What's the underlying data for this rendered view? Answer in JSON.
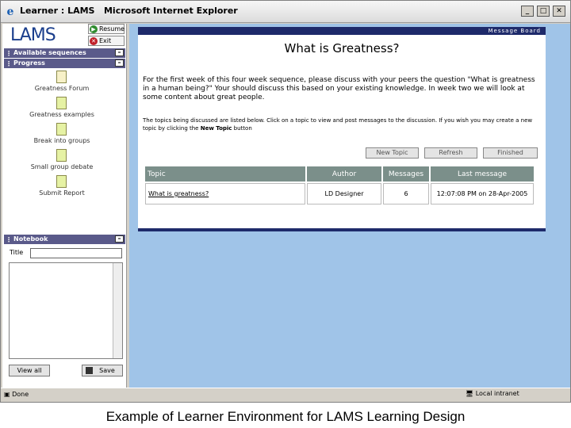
{
  "window": {
    "title": "Learner : LAMS   Microsoft Internet Explorer"
  },
  "sidebar": {
    "logo": "LAMS",
    "resume_label": "Resume",
    "exit_label": "Exit",
    "available_sequences": "Available sequences",
    "progress_title": "Progress",
    "activities": [
      "Greatness Forum",
      "Greatness examples",
      "Break into groups",
      "Small group debate",
      "Submit Report"
    ],
    "notebook": {
      "title": "Notebook",
      "title_label": "Title",
      "view_all": "View all",
      "save": "Save"
    }
  },
  "board": {
    "label": "Message Board",
    "heading": "What is Greatness?",
    "intro": "For the first week of this four week sequence, please discuss with your peers the question \"What is greatness in a human being?\" Your should discuss this based on your existing knowledge. In week two we will look at some content about great people.",
    "instructions_prefix": "The topics being discussed are listed below. Click on a topic to view and post messages to the discussion. If you wish you may create a new topic by clicking the ",
    "instructions_bold": "New Topic",
    "instructions_suffix": " button",
    "buttons": {
      "new_topic": "New Topic",
      "refresh": "Refresh",
      "finished": "Finished"
    },
    "table": {
      "headers": [
        "Topic",
        "Author",
        "Messages",
        "Last message"
      ],
      "rows": [
        {
          "topic": "What is greatness?",
          "author": "LD Designer",
          "messages": "6",
          "last": "12:07:08 PM on 28-Apr-2005"
        }
      ]
    }
  },
  "status": {
    "left": "Done",
    "zone": "Local intranet"
  },
  "caption": "Example of Learner Environment for LAMS Learning Design"
}
